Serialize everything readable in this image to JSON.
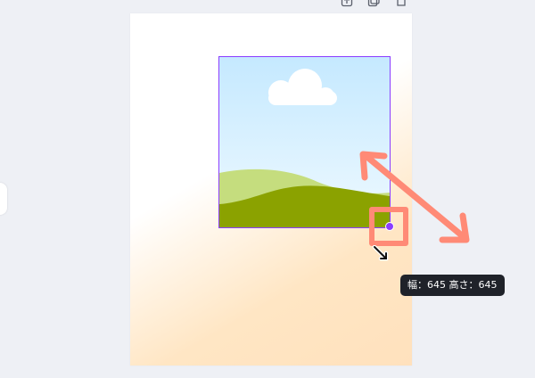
{
  "toolbar": {
    "icons": [
      "upload-icon",
      "duplicate-icon",
      "copy-icon"
    ]
  },
  "selection": {
    "accent_color": "#8b3dff",
    "tooltip": "幅：645 高さ：645"
  },
  "annotation": {
    "color": "#ff8a76"
  }
}
